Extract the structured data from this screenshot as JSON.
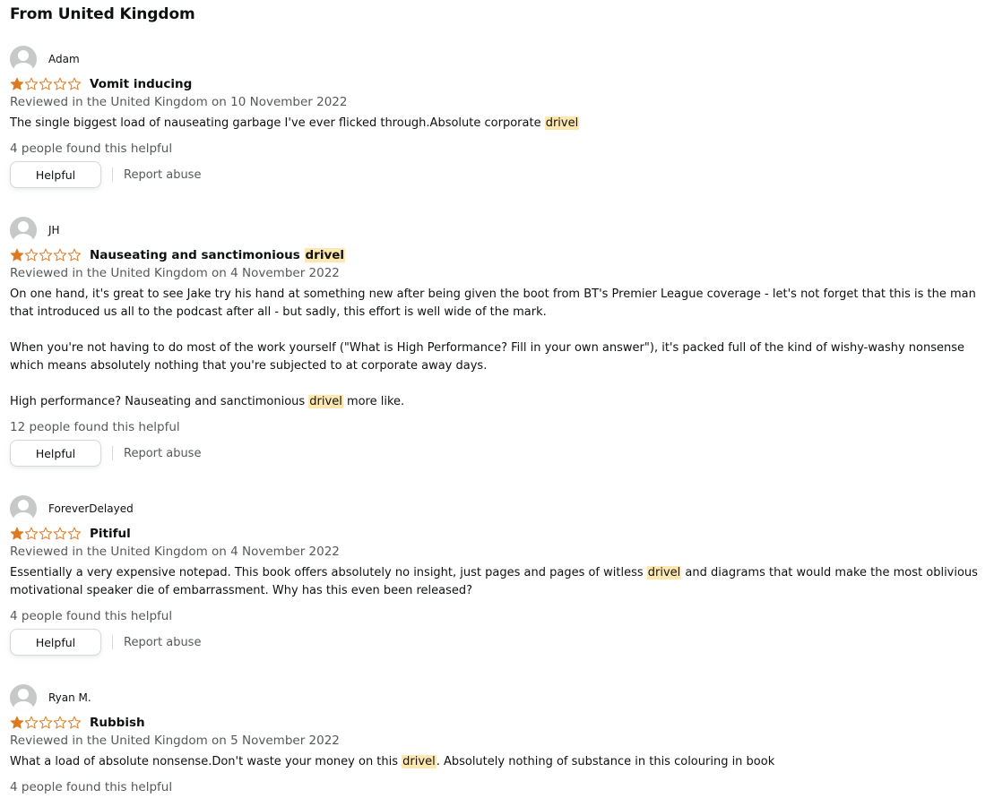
{
  "section_title": "From United Kingdom",
  "reviews": [
    {
      "name": "Adam",
      "title_segments": [
        "Vomit inducing"
      ],
      "date": "Reviewed in the United Kingdom on 10 November 2022",
      "paragraphs": [
        [
          "The single biggest load of nauseating garbage I've ever flicked through.Absolute corporate ",
          "drivel"
        ]
      ],
      "helpful_count": "4 people found this helpful",
      "helpful_label": "Helpful",
      "report_label": "Report abuse",
      "rating": 1
    },
    {
      "name": "JH",
      "title_segments": [
        "Nauseating and sanctimonious ",
        "drivel"
      ],
      "date": "Reviewed in the United Kingdom on 4 November 2022",
      "paragraphs": [
        [
          "On one hand, it's great to see Jake try his hand at something new after being given the boot from BT's Premier League coverage - let's not forget that this is the man that introduced us all to the podcast after all - but sadly, this effort is well wide of the mark."
        ],
        [
          "When you're not having to do most of the work yourself (\"What is High Performance? Fill in your own answer\"), it's packed full of the kind of wishy-washy nonsense which means absolutely nothing that you're subjected to at corporate away days."
        ],
        [
          "High performance? Nauseating and sanctimonious ",
          "drivel",
          " more like."
        ]
      ],
      "helpful_count": "12 people found this helpful",
      "helpful_label": "Helpful",
      "report_label": "Report abuse",
      "rating": 1
    },
    {
      "name": "ForeverDelayed",
      "title_segments": [
        "Pitiful"
      ],
      "date": "Reviewed in the United Kingdom on 4 November 2022",
      "paragraphs": [
        [
          "Essentially a very expensive notepad. This book offers absolutely no insight, just pages and pages of witless ",
          "drivel",
          " and diagrams that would make the most oblivious motivational speaker die of embarrassment. Why has this even been released?"
        ]
      ],
      "helpful_count": "4 people found this helpful",
      "helpful_label": "Helpful",
      "report_label": "Report abuse",
      "rating": 1
    },
    {
      "name": "Ryan M.",
      "title_segments": [
        "Rubbish"
      ],
      "date": "Reviewed in the United Kingdom on 5 November 2022",
      "paragraphs": [
        [
          "What a load of absolute nonsense.Don't waste your money on this ",
          "drivel",
          ". Absolutely nothing of substance in this colouring in book"
        ]
      ],
      "helpful_count": "4 people found this helpful",
      "rating": 1
    }
  ],
  "colors": {
    "star": "#de7921",
    "star_empty": "#de7921",
    "highlight": "#ffe7b0"
  },
  "icons": {
    "avatar": "user-avatar-icon",
    "star_full": "star-filled-icon",
    "star_empty": "star-empty-icon"
  }
}
